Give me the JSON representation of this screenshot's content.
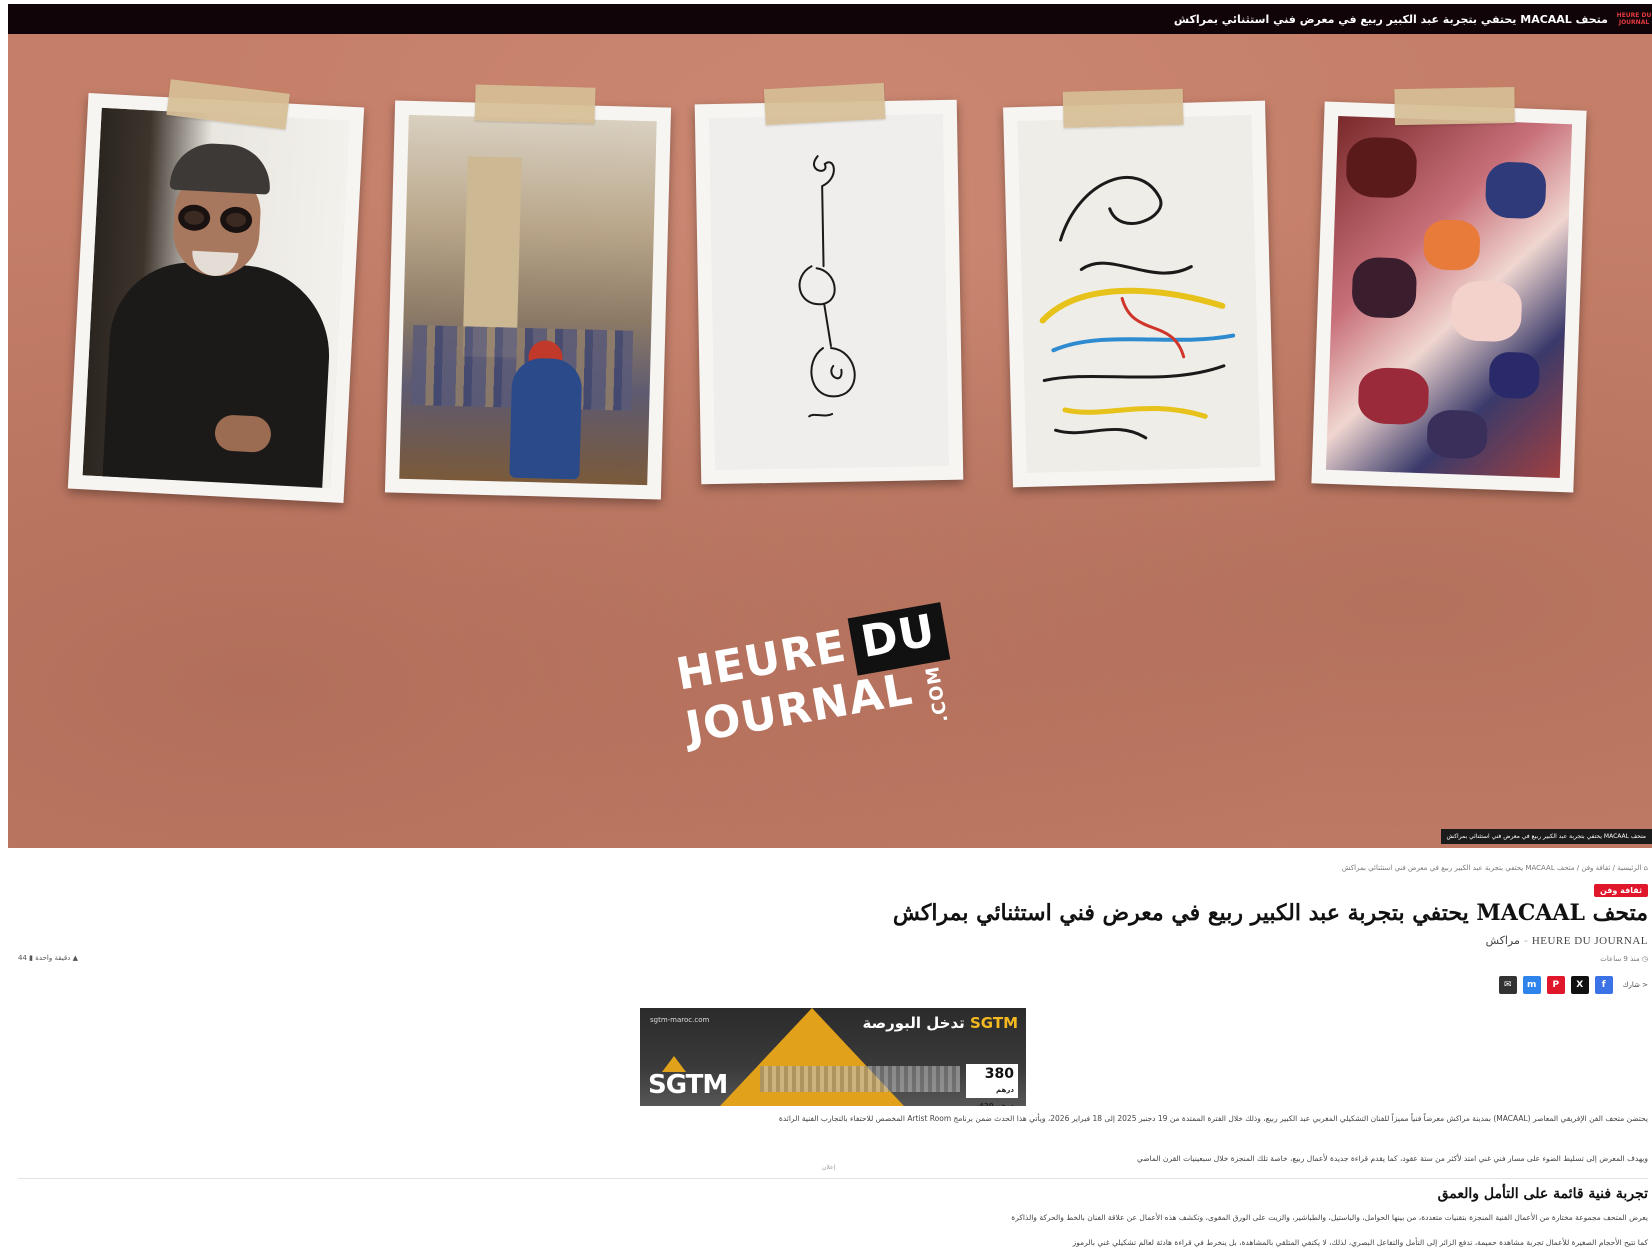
{
  "ticker": {
    "logo_line1": "HEURE DU",
    "logo_line2": "JOURNAL",
    "text": "متحف MACAAL يحتفي بتجربة عبد الكبير ربيع في معرض فني استثنائي بمراكش"
  },
  "hero": {
    "logo_heure": "HEURE",
    "logo_du": "DU",
    "logo_journal": "JOURNAL",
    "logo_com": ".COM",
    "caption": "متحف MACAAL يحتفي بتجربة عبد الكبير ربيع في معرض فني استثنائي بمراكش"
  },
  "article": {
    "breadcrumb": "الرئيسية / ثقافة وفن / متحف MACAAL يحتفي بتجربة عبد الكبير ربيع في معرض فني استثنائي بمراكش",
    "category": "ثقافة وفن",
    "headline": "متحف MACAAL يحتفي بتجربة عبد الكبير ربيع في معرض فني استثنائي بمراكش",
    "byline_source": "HEURE DU JOURNAL",
    "byline_city": "مراكش",
    "time_ago": "منذ 9 ساعات",
    "meta_left": "دقيقة واحدة",
    "meta_left_count": "44",
    "share_label": "شارك",
    "para_1": "يحتضن متحف الفن الإفريقي المعاصر (MACAAL) بمدينة مراكش معرضاً فنياً مميزاً للفنان التشكيلي المغربي عبد الكبير ربيع، وذلك خلال الفترة الممتدة من 19 دجنبر 2025 إلى 18 فبراير 2026، ويأتي هذا الحدث ضمن برنامج Artist Room المخصص للاحتفاء بالتجارب الفنية الرائدة",
    "para_2": "ويهدف المعرض إلى تسليط الضوء على مسار فني غني امتد لأكثر من ستة عقود، كما يقدم قراءة جديدة لأعمال ربيع، خاصة تلك المنجزة خلال سبعينيات القرن الماضي",
    "ad_label": "إعلان",
    "subheading": "تجربة فنية قائمة على التأمل والعمق",
    "para_3": "يعرض المتحف مجموعة مختارة من الأعمال الفنية المنجزة بتقنيات متعددة، من بينها الحوامل، والباستيل، والطباشير، والزيت على الورق المقوى، وتكشف هذه الأعمال عن علاقة الفنان بالخط والحركة والذاكرة",
    "para_4": "كما تتيح الأحجام الصغيرة للأعمال تجربة مشاهدة حميمة، تدفع الزائر إلى التأمل والتفاعل البصري، لذلك، لا يكتفي المتلقي بالمشاهدة، بل ينخرط في قراءة هادئة لعالم تشكيلي غني بالرموز"
  },
  "ad": {
    "site": "sgtm-maroc.com",
    "brand": "SGTM",
    "headline_rest": "تدخل البورصة",
    "logo": "SGTM",
    "price_main": "380",
    "price_unit": "درهم",
    "price_secondary": "420 درهم"
  },
  "colors": {
    "ticker_bg": "#100408",
    "hero_bg": "#c57f69",
    "accent_red": "#e0162b",
    "ad_gold": "#e2a11a"
  }
}
